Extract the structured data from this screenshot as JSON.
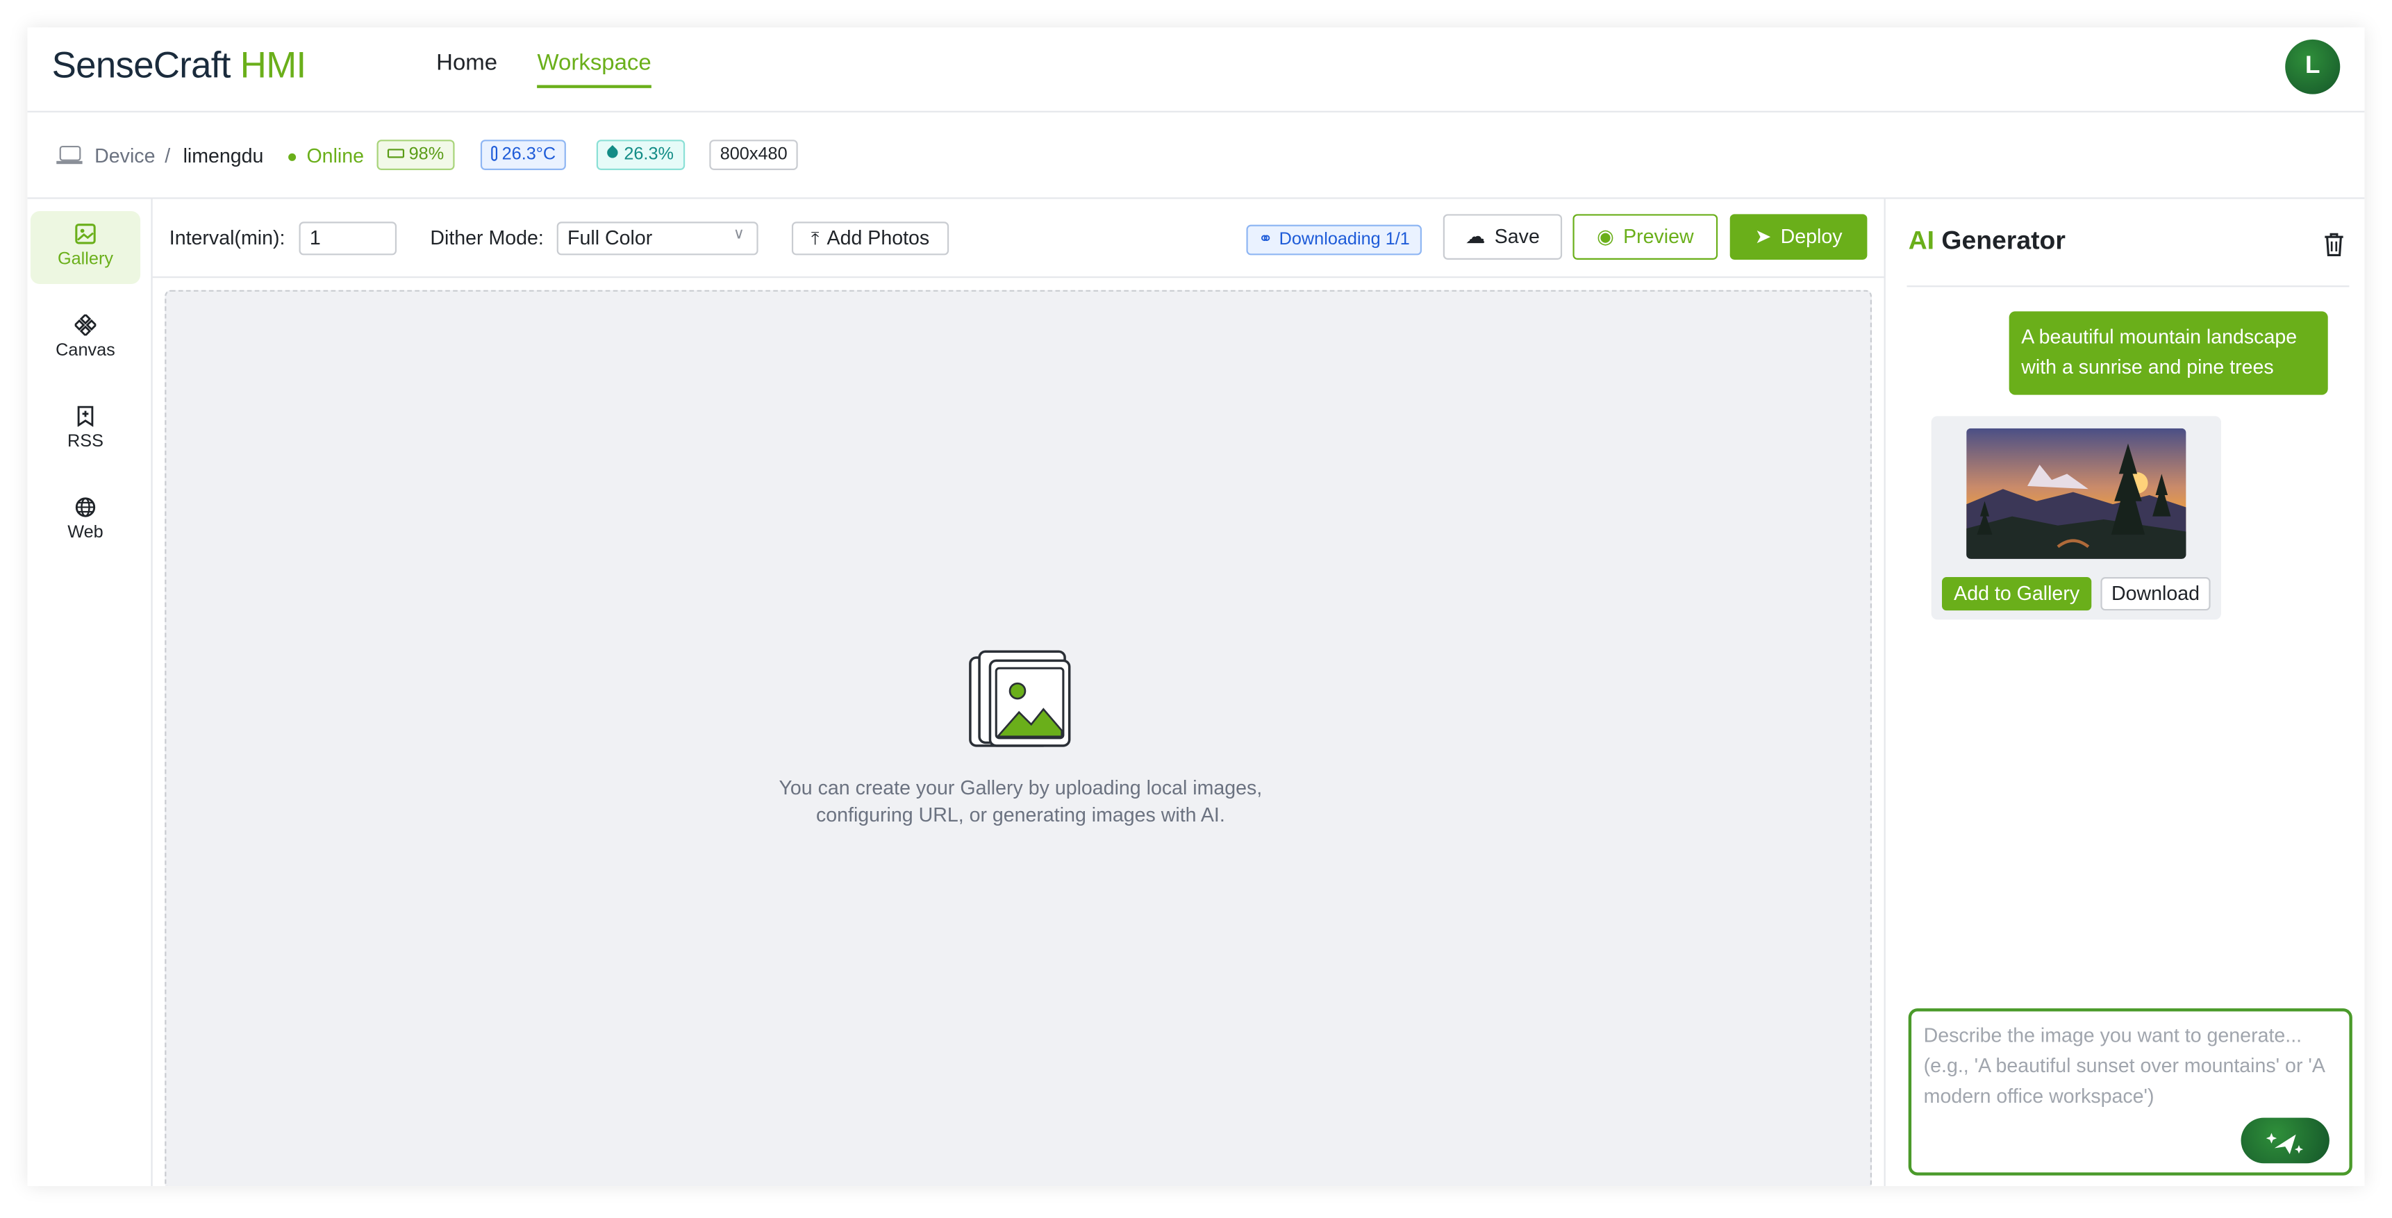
{
  "brand": {
    "name_part1": "SenseCraft",
    "name_part2": "HMI"
  },
  "nav": {
    "home": "Home",
    "workspace": "Workspace"
  },
  "user": {
    "avatar_initial": "L"
  },
  "device": {
    "breadcrumb_root": "Device",
    "separator": "/",
    "name": "limengdu",
    "status": "Online",
    "battery": "98%",
    "temperature": "26.3°C",
    "humidity": "26.3%",
    "resolution": "800x480"
  },
  "sidebar": {
    "items": [
      {
        "label": "Gallery",
        "icon": "image-icon",
        "active": true
      },
      {
        "label": "Canvas",
        "icon": "canvas-icon",
        "active": false
      },
      {
        "label": "RSS",
        "icon": "bookmark-icon",
        "active": false
      },
      {
        "label": "Web",
        "icon": "globe-icon",
        "active": false
      }
    ]
  },
  "toolbar": {
    "interval_label": "Interval(min):",
    "interval_value": "1",
    "dither_label": "Dither Mode:",
    "dither_value": "Full Color",
    "add_photos_label": "Add Photos",
    "download_status": "Downloading 1/1",
    "save_label": "Save",
    "preview_label": "Preview",
    "deploy_label": "Deploy"
  },
  "gallery": {
    "empty_line1": "You can create your Gallery by uploading local images,",
    "empty_line2": "configuring URL, or generating images with AI."
  },
  "ai": {
    "title_prefix": "AI",
    "title_suffix": " Generator",
    "user_message": "A beautiful mountain landscape with a sunrise and pine trees",
    "add_to_gallery_label": "Add to Gallery",
    "download_label": "Download",
    "prompt_placeholder": "Describe the image you want to generate... (e.g., 'A beautiful sunset over mountains' or 'A modern office workspace')"
  },
  "colors": {
    "accent": "#6aaf1a",
    "dark_green": "#15562a",
    "info_blue": "#1d5bd8",
    "teal": "#138c86"
  }
}
